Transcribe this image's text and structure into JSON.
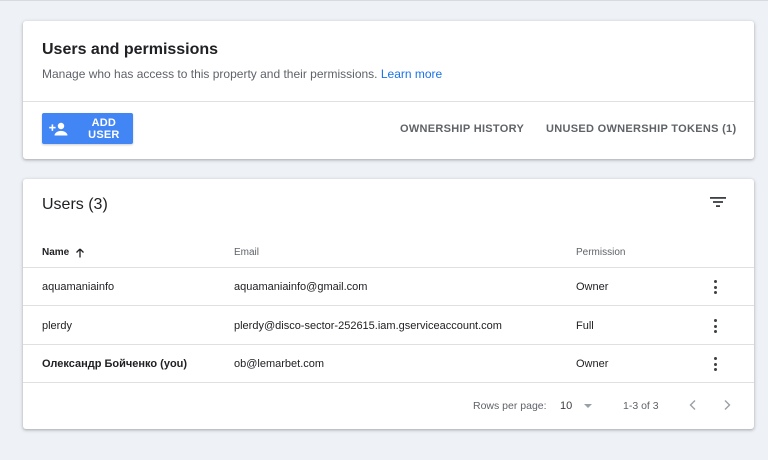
{
  "permissions_card": {
    "title": "Users and permissions",
    "description": "Manage who has access to this property and their permissions.",
    "learn_more": "Learn more",
    "add_user_label": "ADD USER",
    "ownership_history_label": "OWNERSHIP HISTORY",
    "unused_tokens_label": "UNUSED OWNERSHIP TOKENS (1)"
  },
  "users_card": {
    "title": "Users (3)",
    "columns": {
      "name": "Name",
      "email": "Email",
      "permission": "Permission"
    },
    "rows": [
      {
        "name": "aquamaniainfo",
        "email": "aquamaniainfo@gmail.com",
        "permission": "Owner"
      },
      {
        "name": "plerdy",
        "email": "plerdy@disco-sector-252615.iam.gserviceaccount.com",
        "permission": "Full"
      },
      {
        "name": "Олександр Бойченко (you)",
        "email": "ob@lemarbet.com",
        "permission": "Owner"
      }
    ],
    "pagination": {
      "rows_per_page_label": "Rows per page:",
      "rows_per_page_value": "10",
      "range": "1-3 of 3"
    }
  },
  "icons": [
    "add-user-icon",
    "filter-icon",
    "sort-arrow-up-icon",
    "more-vert-icon",
    "chevron-left-icon",
    "chevron-right-icon",
    "dropdown-arrow-icon"
  ],
  "colors": {
    "accent": "#4285f4",
    "link": "#1a73e8",
    "background": "#eef1f5"
  }
}
